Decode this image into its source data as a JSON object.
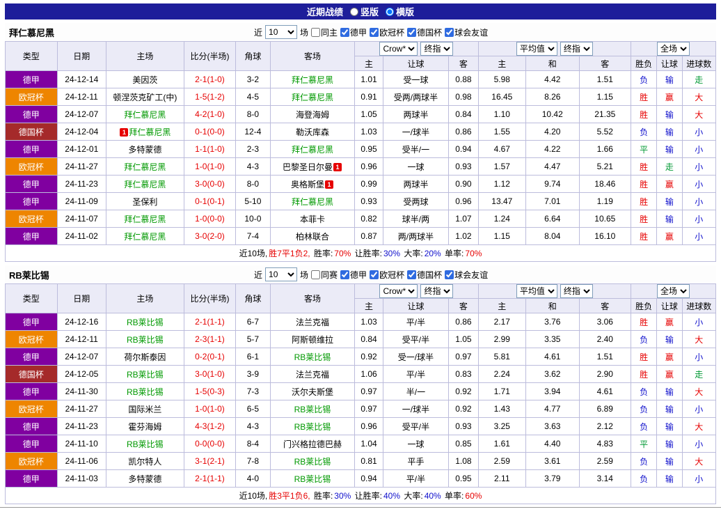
{
  "page": {
    "title": "近期战绩",
    "view_options": [
      {
        "label": "竖版",
        "selected": false
      },
      {
        "label": "横版",
        "selected": true
      }
    ]
  },
  "colors": {
    "league": {
      "德甲": "#8000A0",
      "欧冠杯": "#EE8500",
      "德国杯": "#A52A2A"
    },
    "topbar_navy": "#1e1e9a",
    "focus_team_green": "#009900",
    "score_red": "#E60000",
    "result_red": "#E60000",
    "result_blue": "#1010CC",
    "result_green": "#009933"
  },
  "table_header": {
    "left_cols": [
      "类型",
      "日期",
      "主场",
      "比分(半场)",
      "角球",
      "客场"
    ],
    "odds_group": {
      "company_select": "Crow*",
      "time_select": "终指",
      "cols": [
        "主",
        "让球",
        "客"
      ]
    },
    "avg_group": {
      "company_select": "平均值",
      "time_select": "终指",
      "cols": [
        "主",
        "和",
        "客"
      ]
    },
    "result_group": {
      "scope_select": "全场",
      "cols": [
        "胜负",
        "让球",
        "进球数"
      ]
    }
  },
  "sections": [
    {
      "team": "拜仁慕尼黑",
      "filters": {
        "near_label": "近",
        "count": "10",
        "matches_label": "场",
        "same": {
          "label": "同主",
          "checked": false
        },
        "leagues": [
          {
            "label": "德甲",
            "checked": true
          },
          {
            "label": "欧冠杯",
            "checked": true
          },
          {
            "label": "德国杯",
            "checked": true
          },
          {
            "label": "球会友谊",
            "checked": true
          }
        ]
      },
      "rows": [
        {
          "league": "德甲",
          "date": "24-12-14",
          "home": "美因茨",
          "home_focus": false,
          "home_badge": "",
          "score": "2-1(1-0)",
          "corners": "3-2",
          "away": "拜仁慕尼黑",
          "away_focus": true,
          "away_badge": "",
          "odds": [
            "1.01",
            "受一球",
            "0.88"
          ],
          "avg": [
            "5.98",
            "4.42",
            "1.51"
          ],
          "results": [
            [
              "负",
              "blue"
            ],
            [
              "输",
              "blue"
            ],
            [
              "走",
              "green"
            ]
          ]
        },
        {
          "league": "欧冠杯",
          "date": "24-12-11",
          "home": "顿涅茨克矿工(中)",
          "home_focus": false,
          "home_badge": "",
          "score": "1-5(1-2)",
          "corners": "4-5",
          "away": "拜仁慕尼黑",
          "away_focus": true,
          "away_badge": "",
          "odds": [
            "0.91",
            "受两/两球半",
            "0.98"
          ],
          "avg": [
            "16.45",
            "8.26",
            "1.15"
          ],
          "results": [
            [
              "胜",
              "red"
            ],
            [
              "赢",
              "red"
            ],
            [
              "大",
              "red"
            ]
          ]
        },
        {
          "league": "德甲",
          "date": "24-12-07",
          "home": "拜仁慕尼黑",
          "home_focus": true,
          "home_badge": "",
          "score": "4-2(1-0)",
          "corners": "8-0",
          "away": "海登海姆",
          "away_focus": false,
          "away_badge": "",
          "odds": [
            "1.05",
            "两球半",
            "0.84"
          ],
          "avg": [
            "1.10",
            "10.42",
            "21.35"
          ],
          "results": [
            [
              "胜",
              "red"
            ],
            [
              "输",
              "blue"
            ],
            [
              "大",
              "red"
            ]
          ]
        },
        {
          "league": "德国杯",
          "date": "24-12-04",
          "home": "拜仁慕尼黑",
          "home_focus": true,
          "home_badge": "1",
          "score": "0-1(0-0)",
          "corners": "12-4",
          "away": "勒沃库森",
          "away_focus": false,
          "away_badge": "",
          "odds": [
            "1.03",
            "一/球半",
            "0.86"
          ],
          "avg": [
            "1.55",
            "4.20",
            "5.52"
          ],
          "results": [
            [
              "负",
              "blue"
            ],
            [
              "输",
              "blue"
            ],
            [
              "小",
              "blue"
            ]
          ]
        },
        {
          "league": "德甲",
          "date": "24-12-01",
          "home": "多特蒙德",
          "home_focus": false,
          "home_badge": "",
          "score": "1-1(1-0)",
          "corners": "2-3",
          "away": "拜仁慕尼黑",
          "away_focus": true,
          "away_badge": "",
          "odds": [
            "0.95",
            "受半/一",
            "0.94"
          ],
          "avg": [
            "4.67",
            "4.22",
            "1.66"
          ],
          "results": [
            [
              "平",
              "green"
            ],
            [
              "输",
              "blue"
            ],
            [
              "小",
              "blue"
            ]
          ]
        },
        {
          "league": "欧冠杯",
          "date": "24-11-27",
          "home": "拜仁慕尼黑",
          "home_focus": true,
          "home_badge": "",
          "score": "1-0(1-0)",
          "corners": "4-3",
          "away": "巴黎圣日尔曼",
          "away_focus": false,
          "away_badge": "1",
          "odds": [
            "0.96",
            "一球",
            "0.93"
          ],
          "avg": [
            "1.57",
            "4.47",
            "5.21"
          ],
          "results": [
            [
              "胜",
              "red"
            ],
            [
              "走",
              "green"
            ],
            [
              "小",
              "blue"
            ]
          ]
        },
        {
          "league": "德甲",
          "date": "24-11-23",
          "home": "拜仁慕尼黑",
          "home_focus": true,
          "home_badge": "",
          "score": "3-0(0-0)",
          "corners": "8-0",
          "away": "奥格斯堡",
          "away_focus": false,
          "away_badge": "1",
          "odds": [
            "0.99",
            "两球半",
            "0.90"
          ],
          "avg": [
            "1.12",
            "9.74",
            "18.46"
          ],
          "results": [
            [
              "胜",
              "red"
            ],
            [
              "赢",
              "red"
            ],
            [
              "小",
              "blue"
            ]
          ]
        },
        {
          "league": "德甲",
          "date": "24-11-09",
          "home": "圣保利",
          "home_focus": false,
          "home_badge": "",
          "score": "0-1(0-1)",
          "corners": "5-10",
          "away": "拜仁慕尼黑",
          "away_focus": true,
          "away_badge": "",
          "odds": [
            "0.93",
            "受两球",
            "0.96"
          ],
          "avg": [
            "13.47",
            "7.01",
            "1.19"
          ],
          "results": [
            [
              "胜",
              "red"
            ],
            [
              "输",
              "blue"
            ],
            [
              "小",
              "blue"
            ]
          ]
        },
        {
          "league": "欧冠杯",
          "date": "24-11-07",
          "home": "拜仁慕尼黑",
          "home_focus": true,
          "home_badge": "",
          "score": "1-0(0-0)",
          "corners": "10-0",
          "away": "本菲卡",
          "away_focus": false,
          "away_badge": "",
          "odds": [
            "0.82",
            "球半/两",
            "1.07"
          ],
          "avg": [
            "1.24",
            "6.64",
            "10.65"
          ],
          "results": [
            [
              "胜",
              "red"
            ],
            [
              "输",
              "blue"
            ],
            [
              "小",
              "blue"
            ]
          ]
        },
        {
          "league": "德甲",
          "date": "24-11-02",
          "home": "拜仁慕尼黑",
          "home_focus": true,
          "home_badge": "",
          "score": "3-0(2-0)",
          "corners": "7-4",
          "away": "柏林联合",
          "away_focus": false,
          "away_badge": "",
          "odds": [
            "0.87",
            "两/两球半",
            "1.02"
          ],
          "avg": [
            "1.15",
            "8.04",
            "16.10"
          ],
          "results": [
            [
              "胜",
              "red"
            ],
            [
              "赢",
              "red"
            ],
            [
              "小",
              "blue"
            ]
          ]
        }
      ],
      "summary": [
        [
          "近10场,",
          "black"
        ],
        [
          "胜7平1负2,",
          "red"
        ],
        [
          " 胜率:",
          "black"
        ],
        [
          "70%",
          "red"
        ],
        [
          " 让胜率:",
          "black"
        ],
        [
          "30%",
          "blue"
        ],
        [
          " 大率:",
          "black"
        ],
        [
          "20%",
          "blue"
        ],
        [
          " 单率:",
          "black"
        ],
        [
          "70%",
          "red"
        ]
      ]
    },
    {
      "team": "RB莱比锡",
      "filters": {
        "near_label": "近",
        "count": "10",
        "matches_label": "场",
        "same": {
          "label": "同赛",
          "checked": false
        },
        "leagues": [
          {
            "label": "德甲",
            "checked": true
          },
          {
            "label": "欧冠杯",
            "checked": true
          },
          {
            "label": "德国杯",
            "checked": true
          },
          {
            "label": "球会友谊",
            "checked": true
          }
        ]
      },
      "rows": [
        {
          "league": "德甲",
          "date": "24-12-16",
          "home": "RB莱比锡",
          "home_focus": true,
          "home_badge": "",
          "score": "2-1(1-1)",
          "corners": "6-7",
          "away": "法兰克福",
          "away_focus": false,
          "away_badge": "",
          "odds": [
            "1.03",
            "平/半",
            "0.86"
          ],
          "avg": [
            "2.17",
            "3.76",
            "3.06"
          ],
          "results": [
            [
              "胜",
              "red"
            ],
            [
              "赢",
              "red"
            ],
            [
              "小",
              "blue"
            ]
          ]
        },
        {
          "league": "欧冠杯",
          "date": "24-12-11",
          "home": "RB莱比锡",
          "home_focus": true,
          "home_badge": "",
          "score": "2-3(1-1)",
          "corners": "5-7",
          "away": "阿斯顿维拉",
          "away_focus": false,
          "away_badge": "",
          "odds": [
            "0.84",
            "受平/半",
            "1.05"
          ],
          "avg": [
            "2.99",
            "3.35",
            "2.40"
          ],
          "results": [
            [
              "负",
              "blue"
            ],
            [
              "输",
              "blue"
            ],
            [
              "大",
              "red"
            ]
          ]
        },
        {
          "league": "德甲",
          "date": "24-12-07",
          "home": "荷尔斯泰因",
          "home_focus": false,
          "home_badge": "",
          "score": "0-2(0-1)",
          "corners": "6-1",
          "away": "RB莱比锡",
          "away_focus": true,
          "away_badge": "",
          "odds": [
            "0.92",
            "受一/球半",
            "0.97"
          ],
          "avg": [
            "5.81",
            "4.61",
            "1.51"
          ],
          "results": [
            [
              "胜",
              "red"
            ],
            [
              "赢",
              "red"
            ],
            [
              "小",
              "blue"
            ]
          ]
        },
        {
          "league": "德国杯",
          "date": "24-12-05",
          "home": "RB莱比锡",
          "home_focus": true,
          "home_badge": "",
          "score": "3-0(1-0)",
          "corners": "3-9",
          "away": "法兰克福",
          "away_focus": false,
          "away_badge": "",
          "odds": [
            "1.06",
            "平/半",
            "0.83"
          ],
          "avg": [
            "2.24",
            "3.62",
            "2.90"
          ],
          "results": [
            [
              "胜",
              "red"
            ],
            [
              "赢",
              "red"
            ],
            [
              "走",
              "green"
            ]
          ]
        },
        {
          "league": "德甲",
          "date": "24-11-30",
          "home": "RB莱比锡",
          "home_focus": true,
          "home_badge": "",
          "score": "1-5(0-3)",
          "corners": "7-3",
          "away": "沃尔夫斯堡",
          "away_focus": false,
          "away_badge": "",
          "odds": [
            "0.97",
            "半/一",
            "0.92"
          ],
          "avg": [
            "1.71",
            "3.94",
            "4.61"
          ],
          "results": [
            [
              "负",
              "blue"
            ],
            [
              "输",
              "blue"
            ],
            [
              "大",
              "red"
            ]
          ]
        },
        {
          "league": "欧冠杯",
          "date": "24-11-27",
          "home": "国际米兰",
          "home_focus": false,
          "home_badge": "",
          "score": "1-0(1-0)",
          "corners": "6-5",
          "away": "RB莱比锡",
          "away_focus": true,
          "away_badge": "",
          "odds": [
            "0.97",
            "一/球半",
            "0.92"
          ],
          "avg": [
            "1.43",
            "4.77",
            "6.89"
          ],
          "results": [
            [
              "负",
              "blue"
            ],
            [
              "输",
              "blue"
            ],
            [
              "小",
              "blue"
            ]
          ]
        },
        {
          "league": "德甲",
          "date": "24-11-23",
          "home": "霍芬海姆",
          "home_focus": false,
          "home_badge": "",
          "score": "4-3(1-2)",
          "corners": "4-3",
          "away": "RB莱比锡",
          "away_focus": true,
          "away_badge": "",
          "odds": [
            "0.96",
            "受平/半",
            "0.93"
          ],
          "avg": [
            "3.25",
            "3.63",
            "2.12"
          ],
          "results": [
            [
              "负",
              "blue"
            ],
            [
              "输",
              "blue"
            ],
            [
              "大",
              "red"
            ]
          ]
        },
        {
          "league": "德甲",
          "date": "24-11-10",
          "home": "RB莱比锡",
          "home_focus": true,
          "home_badge": "",
          "score": "0-0(0-0)",
          "corners": "8-4",
          "away": "门兴格拉德巴赫",
          "away_focus": false,
          "away_badge": "",
          "odds": [
            "1.04",
            "一球",
            "0.85"
          ],
          "avg": [
            "1.61",
            "4.40",
            "4.83"
          ],
          "results": [
            [
              "平",
              "green"
            ],
            [
              "输",
              "blue"
            ],
            [
              "小",
              "blue"
            ]
          ]
        },
        {
          "league": "欧冠杯",
          "date": "24-11-06",
          "home": "凯尔特人",
          "home_focus": false,
          "home_badge": "",
          "score": "3-1(2-1)",
          "corners": "7-8",
          "away": "RB莱比锡",
          "away_focus": true,
          "away_badge": "",
          "odds": [
            "0.81",
            "平手",
            "1.08"
          ],
          "avg": [
            "2.59",
            "3.61",
            "2.59"
          ],
          "results": [
            [
              "负",
              "blue"
            ],
            [
              "输",
              "blue"
            ],
            [
              "大",
              "red"
            ]
          ]
        },
        {
          "league": "德甲",
          "date": "24-11-03",
          "home": "多特蒙德",
          "home_focus": false,
          "home_badge": "",
          "score": "2-1(1-1)",
          "corners": "4-0",
          "away": "RB莱比锡",
          "away_focus": true,
          "away_badge": "",
          "odds": [
            "0.94",
            "平/半",
            "0.95"
          ],
          "avg": [
            "2.11",
            "3.79",
            "3.14"
          ],
          "results": [
            [
              "负",
              "blue"
            ],
            [
              "输",
              "blue"
            ],
            [
              "小",
              "blue"
            ]
          ]
        }
      ],
      "summary": [
        [
          "近10场,",
          "black"
        ],
        [
          "胜3平1负6,",
          "red"
        ],
        [
          " 胜率:",
          "black"
        ],
        [
          "30%",
          "blue"
        ],
        [
          " 让胜率:",
          "black"
        ],
        [
          "40%",
          "blue"
        ],
        [
          " 大率:",
          "black"
        ],
        [
          "40%",
          "blue"
        ],
        [
          " 单率:",
          "black"
        ],
        [
          "60%",
          "red"
        ]
      ]
    }
  ]
}
